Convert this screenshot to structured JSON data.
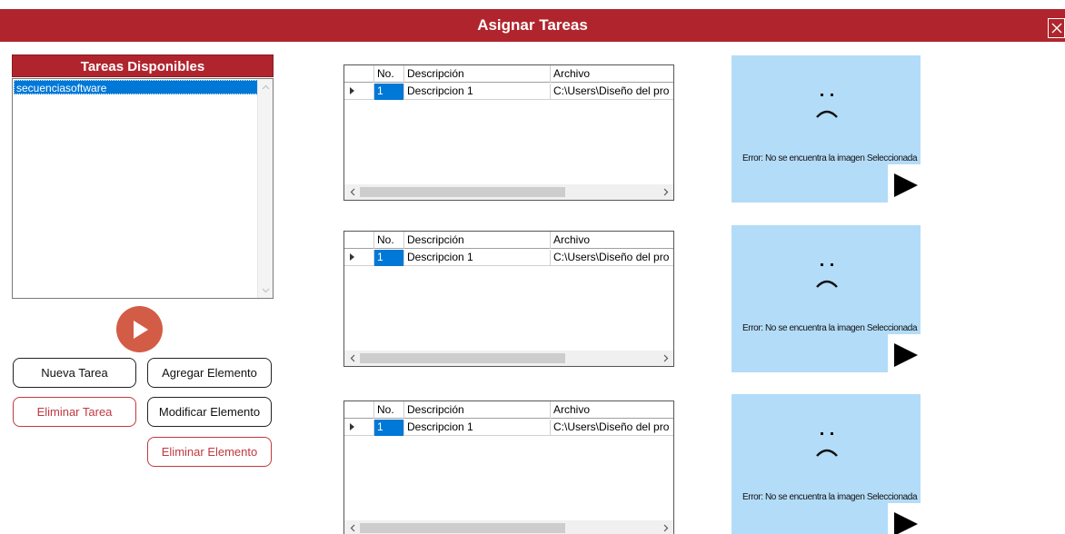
{
  "window": {
    "title": "Asignar Tareas",
    "close_icon": "close-icon"
  },
  "tasks": {
    "header": "Tareas Disponibles",
    "items": [
      "secuenciasoftware"
    ]
  },
  "colors": {
    "accent": "#b0252d",
    "play_button": "#d35c47",
    "selection": "#0078d7",
    "preview_bg": "#b3dcf8",
    "danger": "#c0393f"
  },
  "buttons": {
    "nueva_tarea": "Nueva Tarea",
    "agregar_elemento": "Agregar Elemento",
    "eliminar_tarea": "Eliminar Tarea",
    "modificar_elemento": "Modificar Elemento",
    "eliminar_elemento": "Eliminar Elemento"
  },
  "grids": [
    {
      "columns": [
        "No.",
        "Descripción",
        "Archivo"
      ],
      "rows": [
        {
          "no": "1",
          "descripcion": "Descripcion 1",
          "archivo": "C:\\Users\\Diseño del pro"
        }
      ]
    },
    {
      "columns": [
        "No.",
        "Descripción",
        "Archivo"
      ],
      "rows": [
        {
          "no": "1",
          "descripcion": "Descripcion 1",
          "archivo": "C:\\Users\\Diseño del pro"
        }
      ]
    },
    {
      "columns": [
        "No.",
        "Descripción",
        "Archivo"
      ],
      "rows": [
        {
          "no": "1",
          "descripcion": "Descripcion 1",
          "archivo": "C:\\Users\\Diseño del pro"
        }
      ]
    }
  ],
  "previews": [
    {
      "error": "Error: No se encuentra la imagen Seleccionada"
    },
    {
      "error": "Error: No se encuentra la imagen Seleccionada"
    },
    {
      "error": "Error: No se encuentra la imagen Seleccionada"
    }
  ]
}
